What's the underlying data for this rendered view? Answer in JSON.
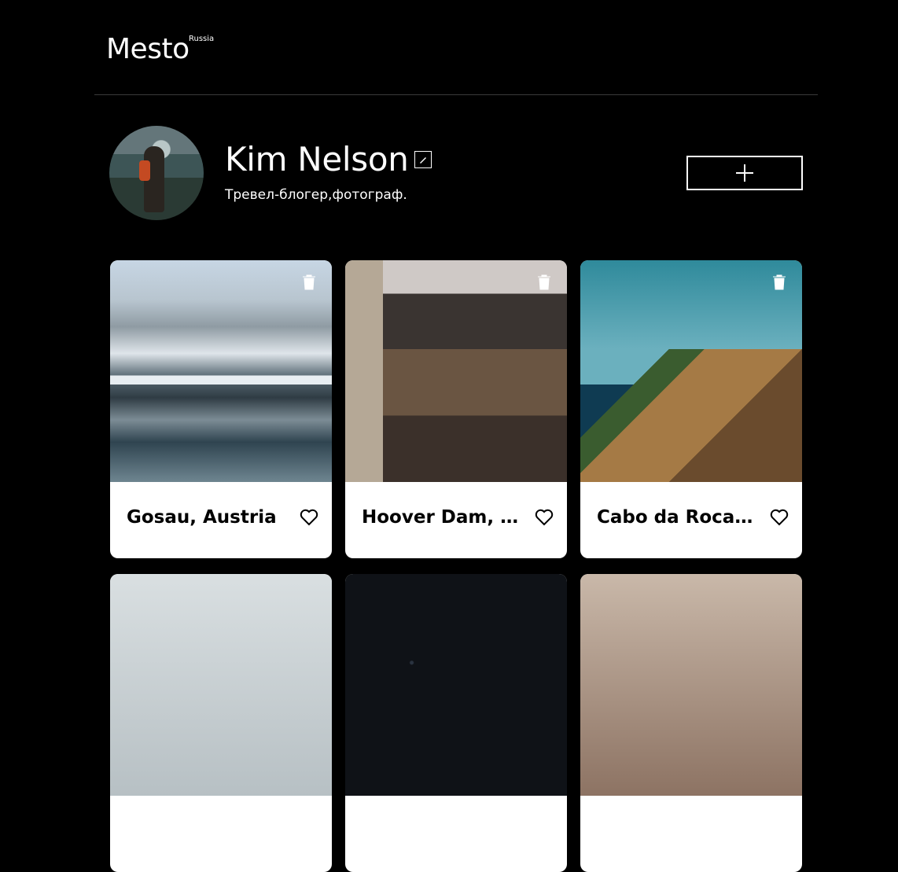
{
  "header": {
    "logo": "Mesto",
    "logo_sup": "Russia"
  },
  "profile": {
    "name": "Kim Nelson",
    "about": "Тревел-блогер,фотограф.",
    "edit_icon": "pencil-icon",
    "add_icon": "plus-icon"
  },
  "cards": [
    {
      "title": "Gosau, Austria",
      "image": "snowy-mountain-lake"
    },
    {
      "title": "Hoover Dam, Boulder City",
      "image": "hoover-dam-bridge"
    },
    {
      "title": "Cabo da Roca, Colares",
      "image": "lighthouse-cliff-sea"
    },
    {
      "title": "",
      "image": "partial-card-4"
    },
    {
      "title": "",
      "image": "partial-card-5"
    },
    {
      "title": "",
      "image": "partial-card-6"
    }
  ],
  "colors": {
    "background": "#000000",
    "card": "#ffffff",
    "divider": "#545454"
  }
}
